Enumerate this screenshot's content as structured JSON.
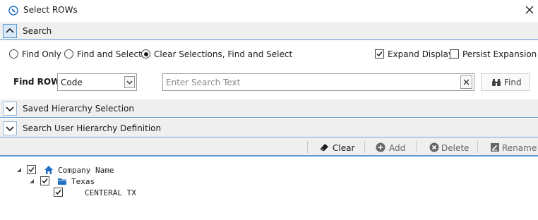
{
  "window": {
    "title": "Select ROWs",
    "icon": "app-globe-icon",
    "close_icon": "close-icon"
  },
  "search_section": {
    "title": "Search",
    "expanded": true
  },
  "search_options": {
    "modes": [
      {
        "label": "Find Only",
        "checked": false
      },
      {
        "label": "Find and Select",
        "checked": false
      },
      {
        "label": "Clear Selections, Find and Select",
        "checked": true
      }
    ],
    "expand_display": {
      "label": "Expand Display",
      "checked": true
    },
    "persist_expansion": {
      "label": "Persist Expansion",
      "checked": false
    }
  },
  "find_row": {
    "label": "Find ROW",
    "field_value": "Code",
    "search_placeholder": "Enter Search Text",
    "search_value": "",
    "find_button_label": "Find"
  },
  "saved_hierarchy_section": {
    "title": "Saved Hierarchy Selection",
    "expanded": false
  },
  "user_hierarchy_section": {
    "title": "Search User Hierarchy Definition",
    "expanded": false
  },
  "toolbar": {
    "clear_label": "Clear",
    "add_label": "Add",
    "delete_label": "Delete",
    "rename_label": "Rename"
  },
  "tree": {
    "nodes": [
      {
        "label": "Company  Name",
        "icon": "home-icon",
        "checked": true,
        "level": 0
      },
      {
        "label": "Texas",
        "icon": "folder-icon",
        "checked": true,
        "level": 1
      },
      {
        "label": "CENTERAL TX",
        "icon": "",
        "checked": true,
        "level": 2
      }
    ]
  },
  "colors": {
    "accent": "#5e9bd2",
    "icon_blue": "#1f6fc5",
    "header_bg": "#efefef"
  }
}
